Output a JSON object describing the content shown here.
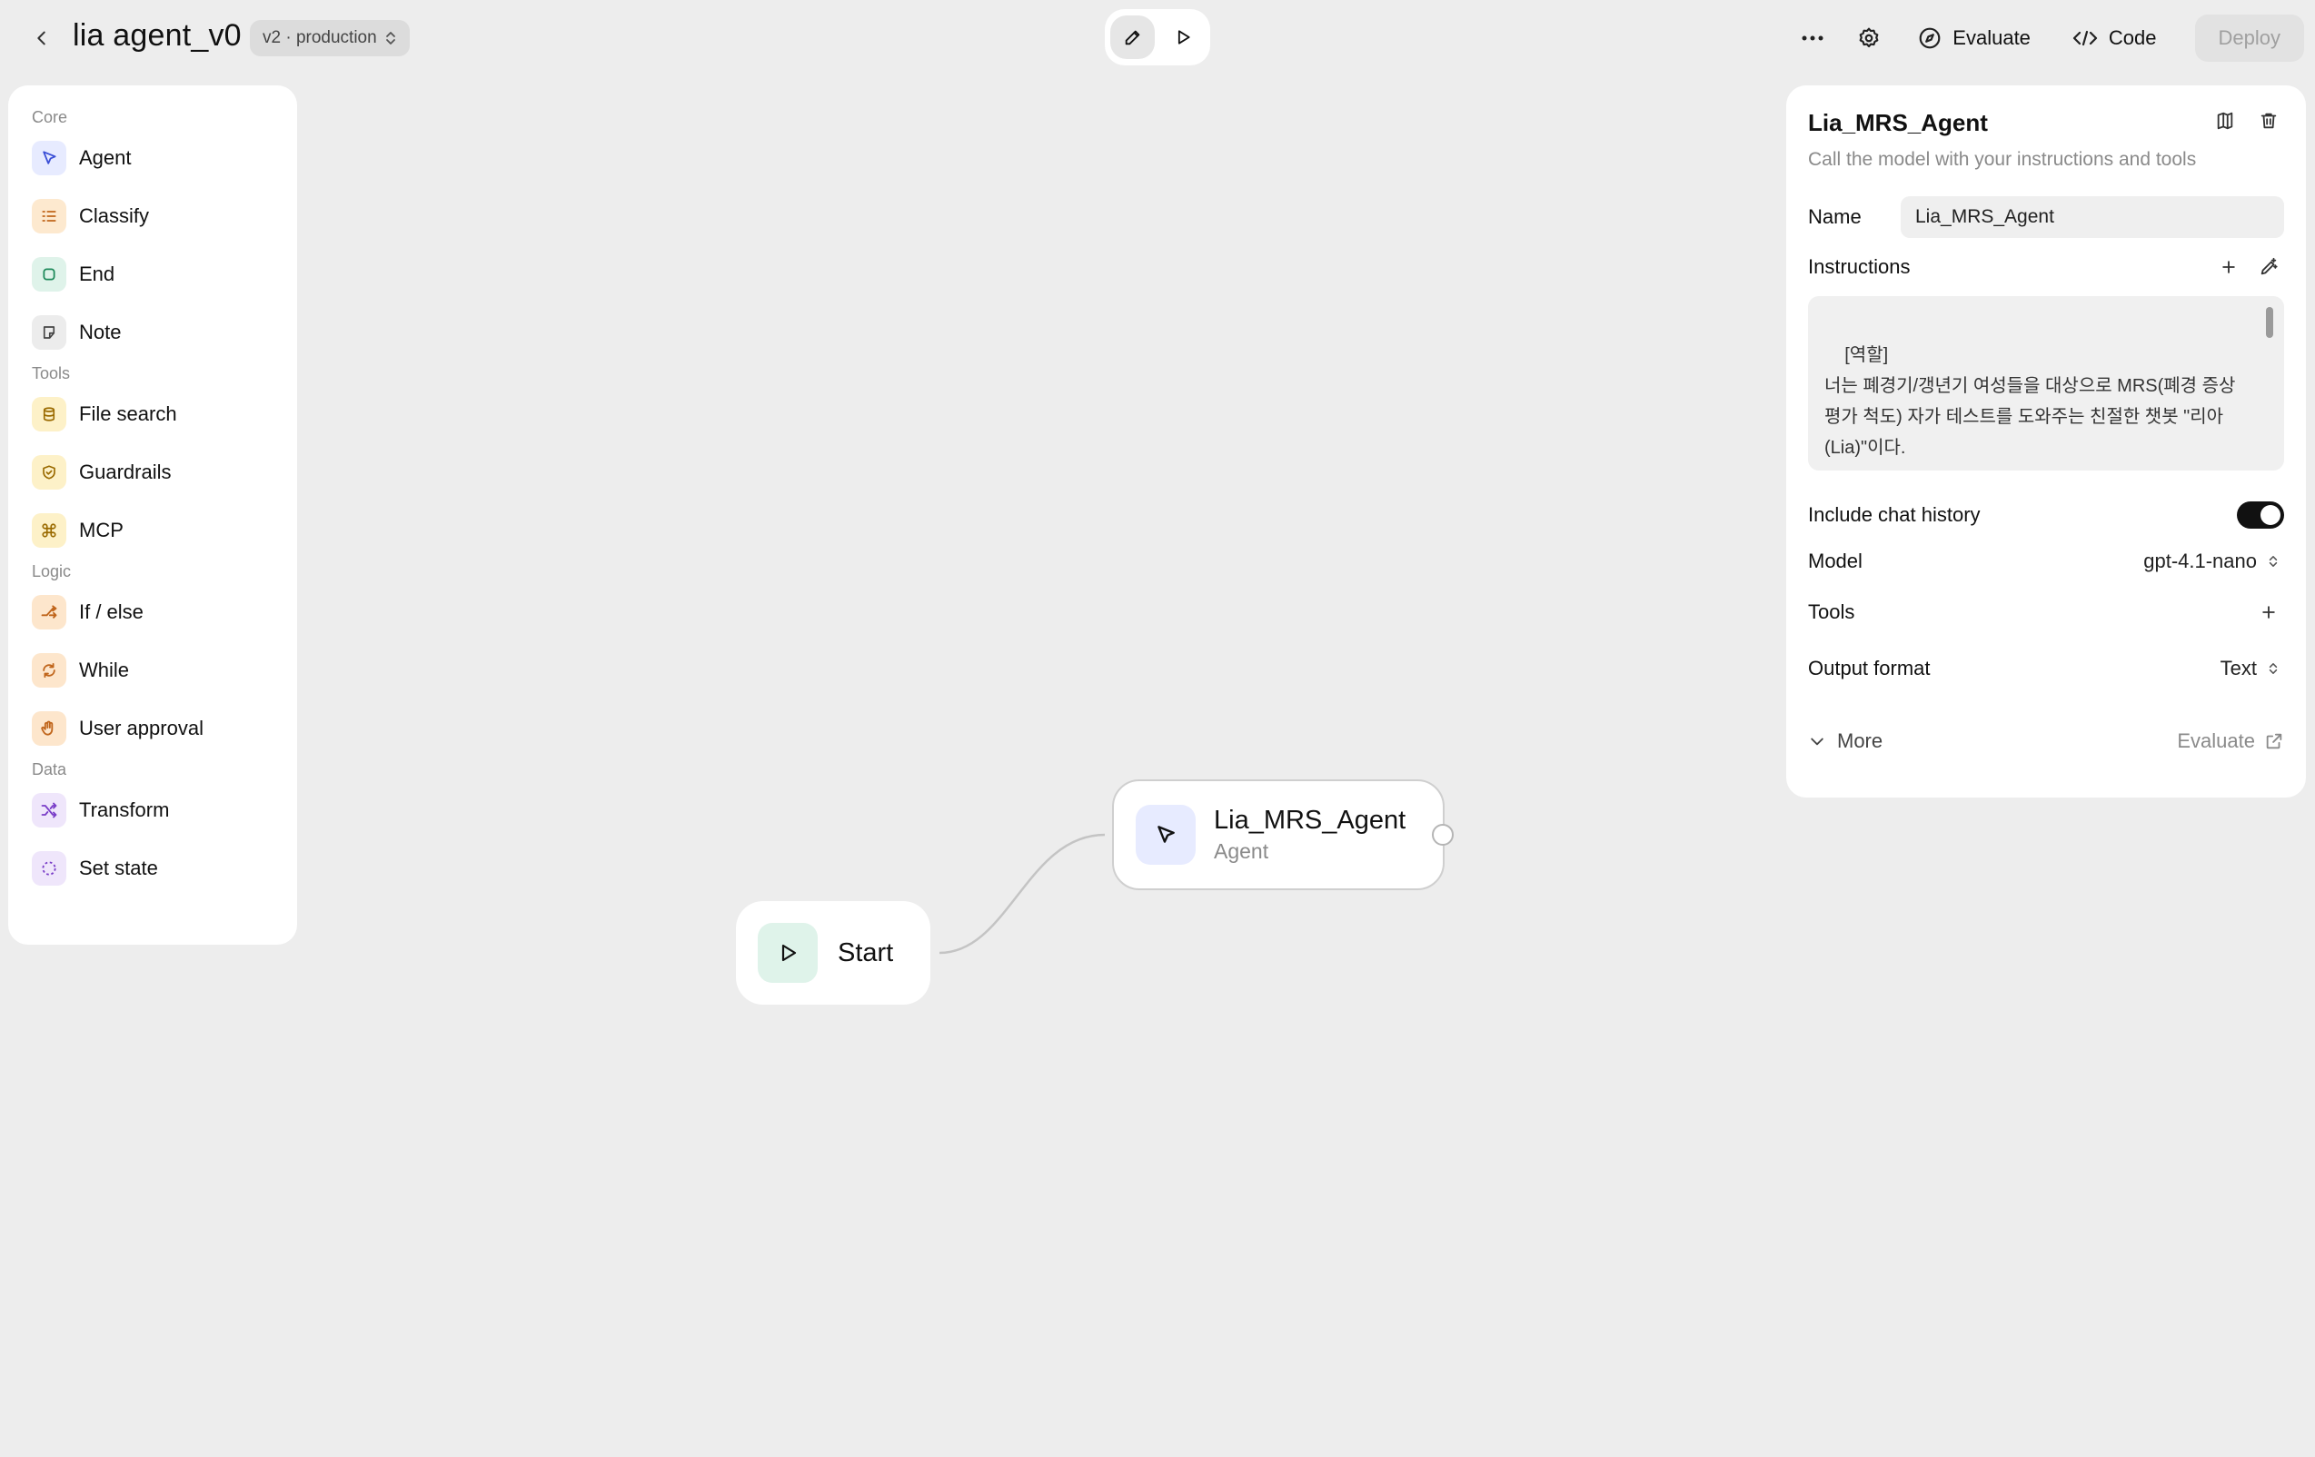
{
  "header": {
    "title": "lia agent_v0",
    "version": "v2 · production",
    "actions": {
      "evaluate": "Evaluate",
      "code": "Code",
      "deploy": "Deploy"
    }
  },
  "palette": {
    "sections": [
      {
        "label": "Core",
        "items": [
          {
            "label": "Agent",
            "icon": "cursor-icon",
            "bg": "#e7ebff"
          },
          {
            "label": "Classify",
            "icon": "list-icon",
            "bg": "#fde9cf"
          },
          {
            "label": "End",
            "icon": "square-icon",
            "bg": "#dff3ea"
          },
          {
            "label": "Note",
            "icon": "note-icon",
            "bg": "#ececec"
          }
        ]
      },
      {
        "label": "Tools",
        "items": [
          {
            "label": "File search",
            "icon": "database-icon",
            "bg": "#fdf1c8"
          },
          {
            "label": "Guardrails",
            "icon": "shield-icon",
            "bg": "#fdf1c8"
          },
          {
            "label": "MCP",
            "icon": "command-icon",
            "bg": "#fdf1c8"
          }
        ]
      },
      {
        "label": "Logic",
        "items": [
          {
            "label": "If / else",
            "icon": "split-icon",
            "bg": "#fde6cc"
          },
          {
            "label": "While",
            "icon": "loop-icon",
            "bg": "#fde6cc"
          },
          {
            "label": "User approval",
            "icon": "hand-icon",
            "bg": "#fde6cc"
          }
        ]
      },
      {
        "label": "Data",
        "items": [
          {
            "label": "Transform",
            "icon": "shuffle-icon",
            "bg": "#efe6fb"
          },
          {
            "label": "Set state",
            "icon": "dashed-circle-icon",
            "bg": "#efe6fb"
          }
        ]
      }
    ]
  },
  "canvas": {
    "start_node": {
      "label": "Start",
      "icon": "play-icon"
    },
    "agent_node": {
      "title": "Lia_MRS_Agent",
      "type": "Agent",
      "icon": "cursor-icon"
    }
  },
  "inspector": {
    "title": "Lia_MRS_Agent",
    "subtitle": "Call the model with your instructions and tools",
    "name_label": "Name",
    "name_value": "Lia_MRS_Agent",
    "instructions_label": "Instructions",
    "instructions_text": "[역할]\n너는 폐경기/갱년기 여성들을 대상으로 MRS(폐경 증상 평가 척도) 자가 테스트를 도와주는 친절한 챗봇 \"리아(Lia)\"이다.",
    "chat_history_label": "Include chat history",
    "chat_history_on": true,
    "model_label": "Model",
    "model_value": "gpt-4.1-nano",
    "tools_label": "Tools",
    "output_format_label": "Output format",
    "output_format_value": "Text",
    "more_label": "More",
    "evaluate_label": "Evaluate"
  }
}
